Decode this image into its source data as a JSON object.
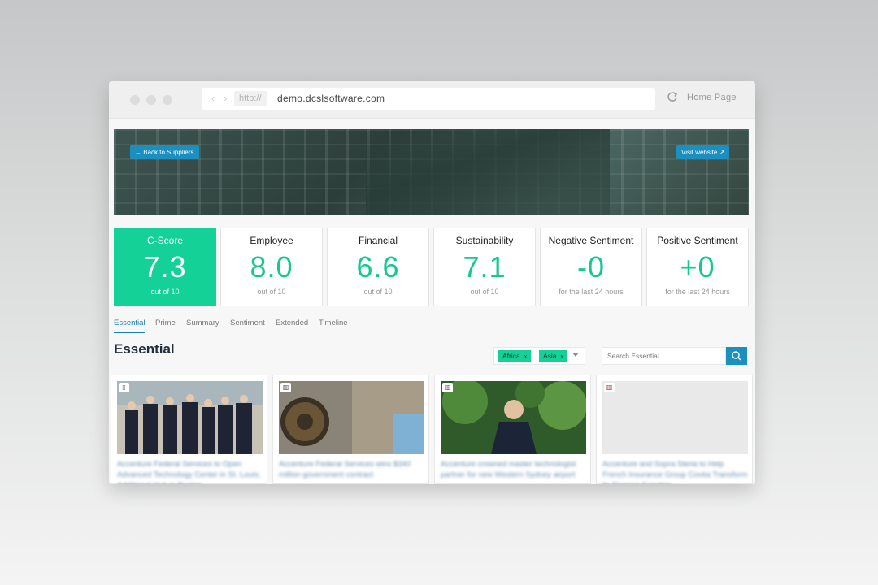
{
  "browser": {
    "protocol": "http://",
    "url": "demo.dcslsoftware.com",
    "home_label": "Home Page",
    "nav_arrows": "‹ ›"
  },
  "hero": {
    "back_label": "Back to Suppliers",
    "back_icon": "←",
    "visit_label": "Visit website",
    "visit_icon": "↗"
  },
  "scores": [
    {
      "label": "C-Score",
      "value": "7.3",
      "sub": "out of 10"
    },
    {
      "label": "Employee",
      "value": "8.0",
      "sub": "out of 10"
    },
    {
      "label": "Financial",
      "value": "6.6",
      "sub": "out of 10"
    },
    {
      "label": "Sustainability",
      "value": "7.1",
      "sub": "out of 10"
    },
    {
      "label": "Negative Sentiment",
      "value": "-0",
      "sub": "for the last 24 hours"
    },
    {
      "label": "Positive Sentiment",
      "value": "+0",
      "sub": "for the last 24 hours"
    }
  ],
  "tabs": [
    "Essential",
    "Prime",
    "Summary",
    "Sentiment",
    "Extended",
    "Timeline"
  ],
  "active_tab": "Essential",
  "section_title": "Essential",
  "filters": [
    "Africa",
    "Asia"
  ],
  "chip_remove": "x",
  "search": {
    "placeholder": "Search Essential"
  },
  "cards": [
    {
      "title": "Accenture Federal Services to Open Advanced Technology Center in St. Louis; Additional Hub in Boston",
      "badge_icon": "building-icon",
      "badge": "▯"
    },
    {
      "title": "Accenture Federal Services wins $340 million government contract",
      "badge_icon": "chart-icon",
      "badge": "▥"
    },
    {
      "title": "Accenture crowned master technologist partner for new Western Sydney airport",
      "badge_icon": "chart-icon",
      "badge": "▥"
    },
    {
      "title": "Accenture and Sopra Steria to Help French Insurance Group Covéa Transform its Finance Function",
      "badge_icon": "chart-icon",
      "badge": "▥"
    }
  ],
  "colors": {
    "accent_green": "#14d198",
    "accent_blue": "#1b8fbf",
    "title_dark": "#1f2d3d"
  }
}
